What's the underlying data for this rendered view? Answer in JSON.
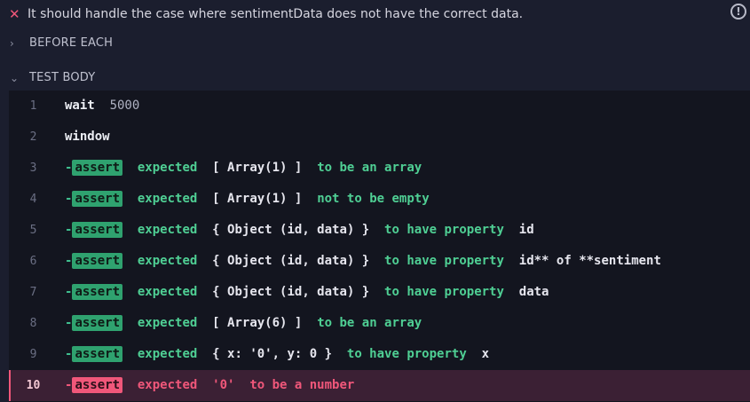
{
  "test": {
    "title": "It should handle the case where sentimentData does not have the correct data.",
    "status_icon": "fail-x-icon",
    "info_icon": "info-circle-icon"
  },
  "sections": {
    "before_each": "BEFORE EACH",
    "test_body": "TEST BODY"
  },
  "commands": [
    {
      "n": "1",
      "cmd": "wait",
      "arg": "5000"
    },
    {
      "n": "2",
      "cmd": "window"
    }
  ],
  "asserts": [
    {
      "n": "3",
      "dash": "-",
      "badge": "assert",
      "expected": "expected",
      "subject": "[ Array(1) ]",
      "phrase": "to be an array",
      "target": ""
    },
    {
      "n": "4",
      "dash": "-",
      "badge": "assert",
      "expected": "expected",
      "subject": "[ Array(1) ]",
      "phrase": "not to be empty",
      "target": ""
    },
    {
      "n": "5",
      "dash": "-",
      "badge": "assert",
      "expected": "expected",
      "subject": "{ Object (id, data) }",
      "phrase": "to have property",
      "target": "id"
    },
    {
      "n": "6",
      "dash": "-",
      "badge": "assert",
      "expected": "expected",
      "subject": "{ Object (id, data) }",
      "phrase": "to have property",
      "target": "id** of **sentiment"
    },
    {
      "n": "7",
      "dash": "-",
      "badge": "assert",
      "expected": "expected",
      "subject": "{ Object (id, data) }",
      "phrase": "to have property",
      "target": "data"
    },
    {
      "n": "8",
      "dash": "-",
      "badge": "assert",
      "expected": "expected",
      "subject": "[ Array(6) ]",
      "phrase": "to be an array",
      "target": ""
    },
    {
      "n": "9",
      "dash": "-",
      "badge": "assert",
      "expected": "expected",
      "subject": "{ x: '0', y: 0 }",
      "phrase": "to have property",
      "target": "x"
    }
  ],
  "failed": {
    "n": "10",
    "dash": "-",
    "badge": "assert",
    "expected": "expected",
    "subject": "'0'",
    "phrase": "to be a number"
  },
  "colors": {
    "fail": "#f0577a",
    "pass": "#2fa26f",
    "bg": "#1b1e2e"
  }
}
